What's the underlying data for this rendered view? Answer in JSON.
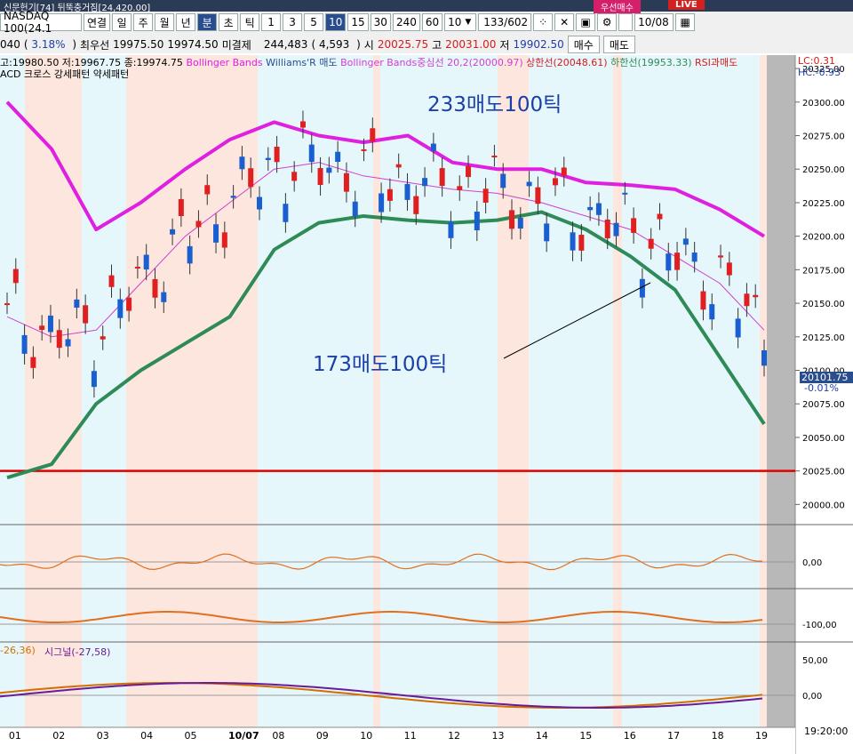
{
  "toolbar": {
    "banner_left": "신문헌기[74] 뒤뚝충거짐[24,420.00]",
    "banner_right": "우선매수",
    "live": "LIVE",
    "symbol": "NASDAQ 100(24.1",
    "buttons": [
      "연결",
      "일",
      "주",
      "월",
      "년",
      "분",
      "초",
      "틱",
      "1",
      "3",
      "5",
      "10",
      "15",
      "30",
      "240",
      "60"
    ],
    "active": [
      "분",
      "10"
    ],
    "period_value": "10",
    "count_value": "133",
    "count_total": "/602",
    "date_value": "10/08"
  },
  "info": {
    "code": "040",
    "change_pct": "3.18%",
    "bid_label": "최우선",
    "bid1": "19975.50",
    "bid2": "19974.50",
    "oi_label": "미결제",
    "oi": "244,483",
    "oi_change": "4,593",
    "open_label": "시",
    "open": "20025.75",
    "high_label": "고",
    "high": "20031.00",
    "low_label": "저",
    "low": "19902.50",
    "buy": "매수",
    "sell": "매도"
  },
  "legend": {
    "ohlc": "고:19980.50 저:19967.75 종:19974.75",
    "bb": "Bollinger Bands",
    "wr": "Williams'R 매도",
    "bbmid": "Bollinger Bands중심선 20,2(20000.97)",
    "upper": "상한선(20048.61)",
    "lower": "하한선(19953.33)",
    "rsi": "RSI과매도",
    "lc": "LC:0.31",
    "hc": "HC:-0.93",
    "macd": "ACD 크로스 강세패턴  약세패턴",
    "macd_val": "-26,36)",
    "signal": "시그널(-27,58)"
  },
  "annotations": {
    "a1": "233매도100틱",
    "a2": "173매도100틱"
  },
  "current": {
    "price": "20101.75",
    "pct": "-0.01%"
  },
  "time_label": "19:20:00",
  "chart_data": {
    "type": "line",
    "x": [
      "01",
      "02",
      "03",
      "04",
      "05",
      "10/07",
      "08",
      "09",
      "10",
      "11",
      "12",
      "13",
      "14",
      "15",
      "16",
      "17",
      "18",
      "19"
    ],
    "yticks": [
      20000,
      20025,
      20050,
      20075,
      20100,
      20125,
      20150,
      20175,
      20200,
      20225,
      20250,
      20275,
      20300,
      20325
    ],
    "ylim": [
      19985,
      20335
    ],
    "support_line": 20025,
    "series": [
      {
        "name": "상한선",
        "color": "#e020e0",
        "values": [
          20300,
          20265,
          20205,
          20225,
          20250,
          20272,
          20285,
          20275,
          20270,
          20275,
          20255,
          20250,
          20250,
          20240,
          20238,
          20235,
          20220,
          20200
        ]
      },
      {
        "name": "Bollinger Bands중심선",
        "color": "#d040d0",
        "values": [
          20140,
          20125,
          20130,
          20165,
          20200,
          20225,
          20250,
          20255,
          20245,
          20240,
          20235,
          20232,
          20225,
          20215,
          20205,
          20185,
          20165,
          20130
        ]
      },
      {
        "name": "하한선",
        "color": "#2e8b57",
        "values": [
          20020,
          20030,
          20075,
          20100,
          20120,
          20140,
          20190,
          20210,
          20215,
          20212,
          20210,
          20212,
          20218,
          20205,
          20185,
          20160,
          20110,
          20060
        ]
      }
    ],
    "osc_ticks": [
      "0,00"
    ],
    "wr_ticks": [
      "-100,00"
    ],
    "macd_ticks": [
      "50,00",
      "0,00"
    ]
  }
}
